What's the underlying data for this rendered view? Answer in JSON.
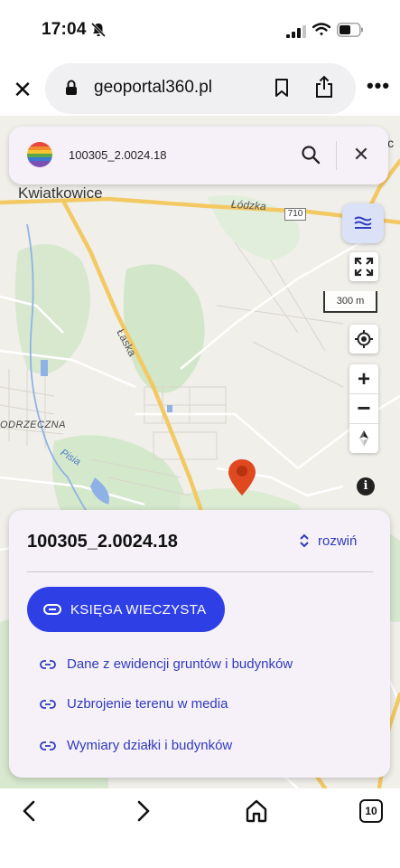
{
  "status_bar": {
    "time": "17:04",
    "icons": [
      "bell-slash-icon",
      "signal-icon",
      "wifi-icon",
      "battery-icon"
    ]
  },
  "browser": {
    "url": "geoportal360.pl",
    "tab_count": "10",
    "more_label": "•••",
    "close_label": "✕",
    "icons": [
      "close-icon",
      "lock-icon",
      "bookmark-icon",
      "share-icon",
      "more-icon",
      "back-icon",
      "forward-icon",
      "home-icon",
      "tabs-icon"
    ]
  },
  "search": {
    "query": "100305_2.0024.18",
    "clear_label": "✕"
  },
  "map": {
    "labels": {
      "kwiatkowice": "Kwiatkowice",
      "lodzka": "Łódzka",
      "road_710": "710",
      "laska": "Łaska",
      "odrzeczna": "ODRZECZNA",
      "pisia": "Pisia",
      "partial_top_right": "ic"
    },
    "scale": "300 m",
    "controls": {
      "zoom_in": "+",
      "zoom_out": "−",
      "info": "i"
    },
    "colors": {
      "background": "#f1efea",
      "forest": "#cfe6c6",
      "water": "#8fb2e6",
      "major_road": "#f3c964",
      "pin": "#e0481f"
    }
  },
  "parcel": {
    "title": "100305_2.0024.18",
    "expand_label": "rozwiń",
    "kw_button_label": "KSIĘGA WIECZYSTA",
    "links": [
      "Dane z ewidencji gruntów i budynków",
      "Uzbrojenie terenu w media",
      "Wymiary działki i budynków"
    ]
  },
  "colors": {
    "accent": "#2f3fe6",
    "link": "#2f3bbf",
    "sheet_bg": "#f6f0f8"
  }
}
